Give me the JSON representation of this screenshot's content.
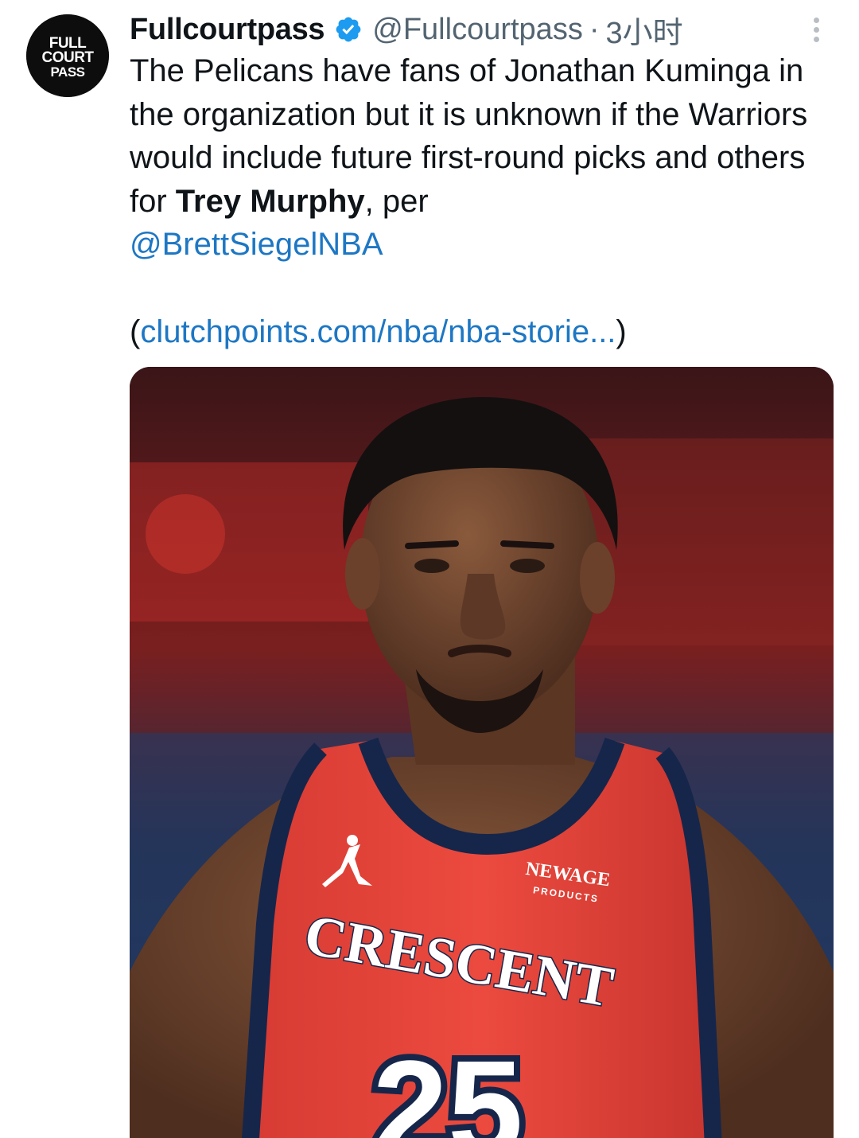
{
  "tweet": {
    "author": {
      "display_name": "Fullcourtpass",
      "handle": "@Fullcourtpass",
      "separator": "·",
      "time": "3小时",
      "avatar_text": [
        "FULL",
        "COURT",
        "PASS"
      ],
      "verified": true
    },
    "text": {
      "part1": "The Pelicans have fans of Jonathan Kuminga in the organization but it is unknown if the Warriors would include future first-round picks and others for ",
      "bold": "Trey Murphy",
      "part2": ", per",
      "mention": "@BrettSiegelNBA"
    },
    "link": {
      "open_paren": "(",
      "url": "clutchpoints.com/nba/nba-storie...",
      "close_paren": ")"
    },
    "media": {
      "jersey_wordmark": "CRESCENT",
      "jersey_number": "25",
      "sponsor_line1": "NEWAGE",
      "sponsor_line2": "PRODUCTS"
    }
  },
  "colors": {
    "text_primary": "#0f1419",
    "text_secondary": "#536471",
    "link": "#1d77c4",
    "verified": "#1d9bf0",
    "jersey_red": "#e8453a",
    "jersey_navy": "#16264a"
  },
  "icons": {
    "verified": "verified-badge-icon",
    "more": "more-options-icon"
  }
}
